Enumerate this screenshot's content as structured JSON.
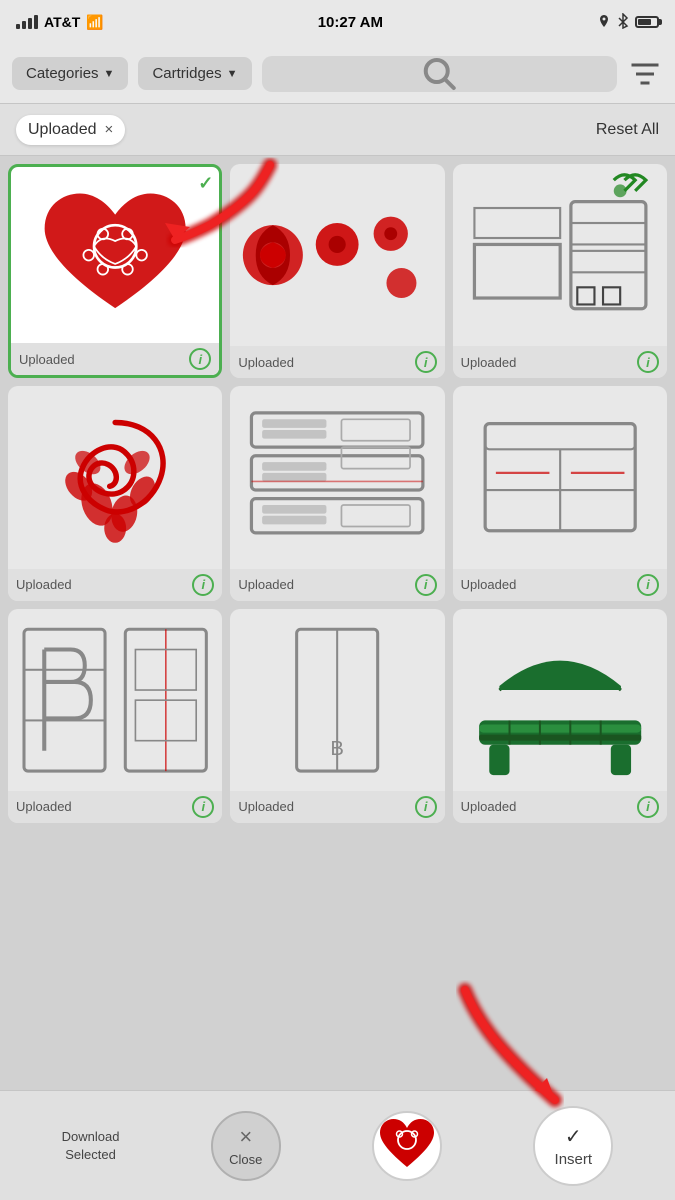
{
  "statusBar": {
    "carrier": "AT&T",
    "time": "10:27 AM",
    "batteryLevel": 70
  },
  "navBar": {
    "categoriesLabel": "Categories",
    "cartridgesLabel": "Cartridges",
    "searchPlaceholder": "Search",
    "caretSymbol": "▼"
  },
  "filterBar": {
    "filterTag": "Uploaded",
    "resetLabel": "Reset All"
  },
  "cards": [
    {
      "id": 1,
      "label": "Uploaded",
      "selected": true
    },
    {
      "id": 2,
      "label": "Uploaded",
      "selected": false
    },
    {
      "id": 3,
      "label": "Uploaded",
      "selected": false
    },
    {
      "id": 4,
      "label": "Uploaded",
      "selected": false
    },
    {
      "id": 5,
      "label": "Uploaded",
      "selected": false
    },
    {
      "id": 6,
      "label": "Uploaded",
      "selected": false
    },
    {
      "id": 7,
      "label": "Uploaded",
      "selected": false
    },
    {
      "id": 8,
      "label": "Uploaded",
      "selected": false
    },
    {
      "id": 9,
      "label": "Uploaded",
      "selected": false
    }
  ],
  "bottomBar": {
    "downloadLabel1": "Download",
    "downloadLabel2": "Selected",
    "closeLabel": "Close",
    "insertLabel": "Insert",
    "checkSymbol": "✓",
    "closeSymbol": "×"
  },
  "infoSymbol": "i"
}
